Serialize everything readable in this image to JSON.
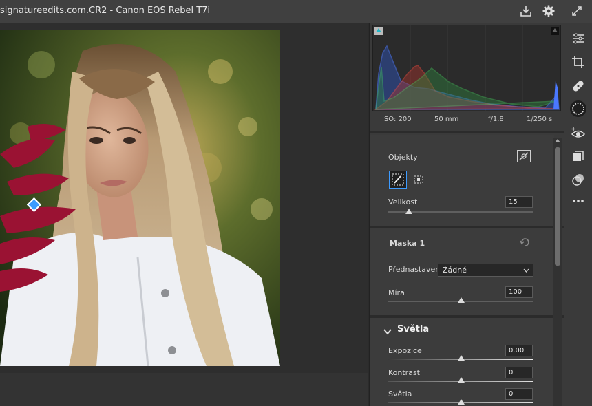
{
  "window": {
    "title": "signatureedits.com.CR2  -  Canon EOS Rebel T7i"
  },
  "histogram": {
    "iso": "ISO: 200",
    "focal": "50 mm",
    "aperture": "f/1.8",
    "shutter": "1/250 s"
  },
  "objects": {
    "title": "Objekty",
    "size_label": "Velikost",
    "size_value": "15"
  },
  "mask": {
    "title": "Maska 1",
    "preset_label": "Přednastavení",
    "preset_value": "Žádné",
    "amount_label": "Míra",
    "amount_value": "100"
  },
  "light": {
    "title": "Světla",
    "exposure_label": "Expozice",
    "exposure_value": "0.00",
    "contrast_label": "Kontrast",
    "contrast_value": "0",
    "highlights_label": "Světla",
    "highlights_value": "0"
  },
  "icons": [
    "download-icon",
    "gear-icon",
    "expand-icon",
    "edit-sliders-icon",
    "crop-icon",
    "healing-icon",
    "masking-icon",
    "redeye-icon",
    "presets-icon",
    "snapshots-icon",
    "more-icon"
  ],
  "colors": {
    "accent": "#3d9bff",
    "panel": "#3a3a3a",
    "titlebar": "#404040"
  }
}
